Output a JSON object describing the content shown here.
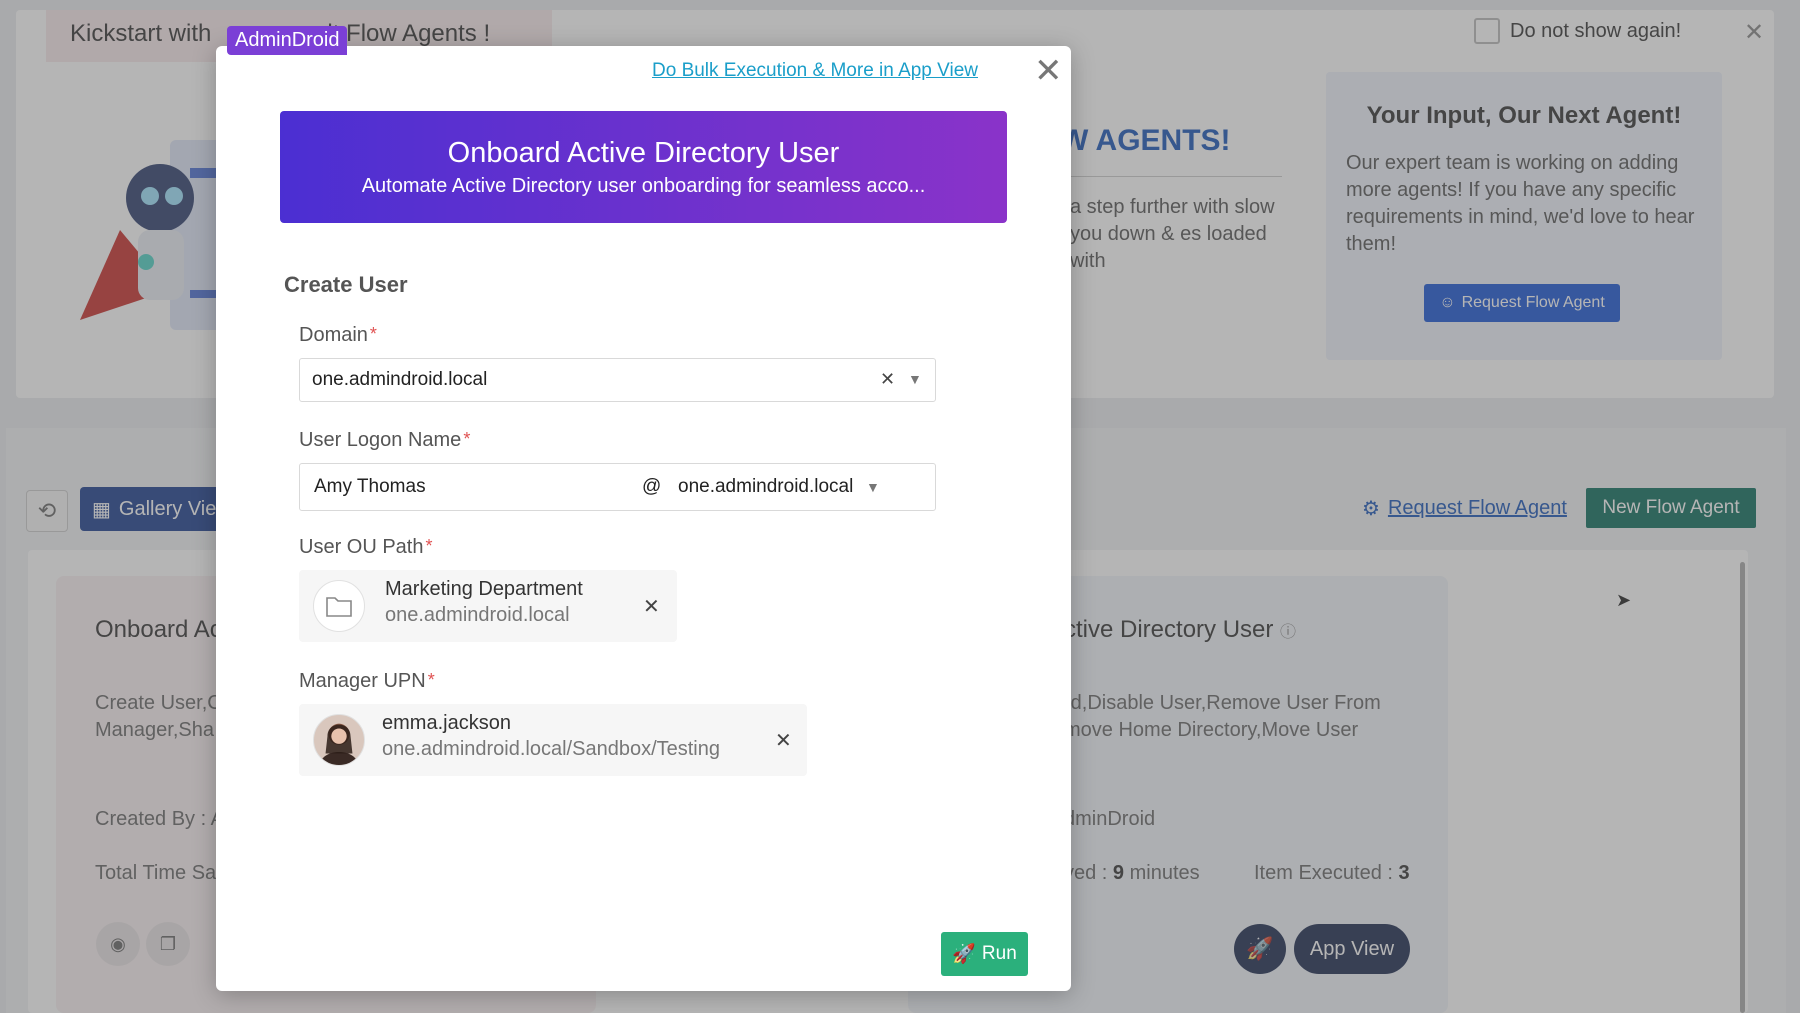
{
  "background": {
    "banner_text_left": "Kickstart with",
    "banner_text_right": "lt Flow Agents !",
    "brand_badge": "AdminDroid",
    "do_not_show": "Do not show again!",
    "agents_heading": "W AGENTS!",
    "agents_paragraph": "a step further with slow you down & es loaded with",
    "input_card": {
      "title": "Your Input, Our Next Agent!",
      "text": "Our expert team is working on adding more agents! If you have any specific requirements in mind, we'd love to hear them!",
      "button": "Request Flow Agent"
    },
    "toolbar": {
      "gallery_view": "Gallery Vie",
      "request_link": "Request Flow Agent",
      "new_agent": "New Flow Agent"
    },
    "card_left": {
      "title": "Onboard Ac",
      "desc_line1": "Create User,C",
      "desc_line2": "Manager,Sha",
      "created_by": "Created By : A",
      "time_saved": "Total Time Sa"
    },
    "card_right": {
      "title": "ctive Directory User",
      "desc_line1": "rd,Disable User,Remove User From",
      "desc_line2": "move Home Directory,Move User",
      "created_by": "dminDroid",
      "time_prefix": "ved : ",
      "time_value": "9",
      "time_unit": " minutes",
      "items_label": "Item Executed : ",
      "items_value": "3",
      "app_view": "App View"
    }
  },
  "modal": {
    "bulk_link": "Do Bulk Execution & More in App View",
    "banner_title": "Onboard Active Directory User",
    "banner_subtitle": "Automate Active Directory user onboarding for seamless acco...",
    "section_title": "Create User",
    "domain": {
      "label": "Domain",
      "value": "one.admindroid.local"
    },
    "logon": {
      "label": "User Logon Name",
      "name": "Amy Thomas",
      "at": "@",
      "domain": "one.admindroid.local"
    },
    "ou": {
      "label": "User OU Path",
      "name": "Marketing Department",
      "sub": "one.admindroid.local"
    },
    "manager": {
      "label": "Manager UPN",
      "name": "emma.jackson",
      "sub": "one.admindroid.local/Sandbox/Testing"
    },
    "run_label": "Run"
  },
  "colors": {
    "brand": "#7b3fd6",
    "banner_start": "#4b2fd2",
    "banner_end": "#8a33c9",
    "run": "#2bb07c",
    "link": "#1a9ec9",
    "new_agent": "#0d6e5d"
  }
}
